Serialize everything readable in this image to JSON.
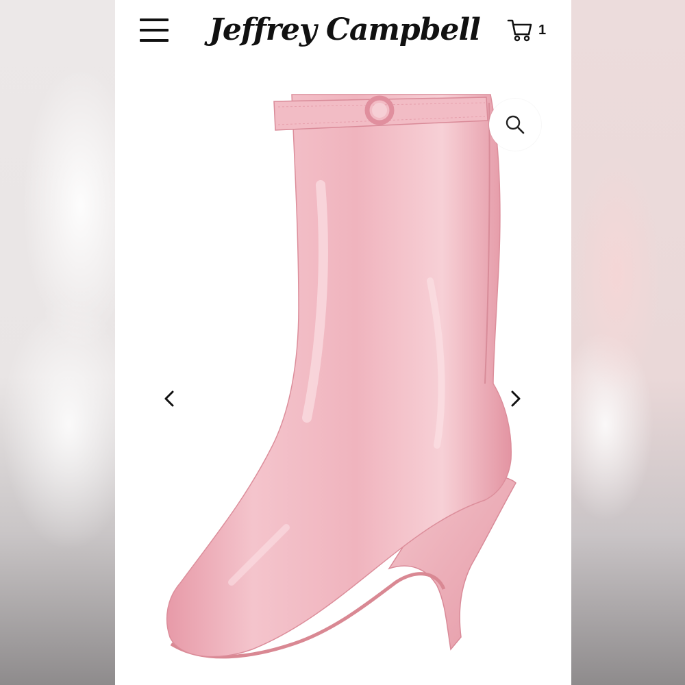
{
  "header": {
    "brand": "Jeffrey Campbell",
    "menu_icon": "hamburger-menu-icon",
    "cart_icon": "shopping-cart-icon",
    "cart_count": "1"
  },
  "gallery": {
    "zoom_icon": "magnifier-icon",
    "prev_icon": "chevron-left-icon",
    "next_icon": "chevron-right-icon",
    "product_color": "#f0b8c0"
  },
  "colors": {
    "text": "#111111",
    "boot_pink": "#f0b8c0"
  }
}
